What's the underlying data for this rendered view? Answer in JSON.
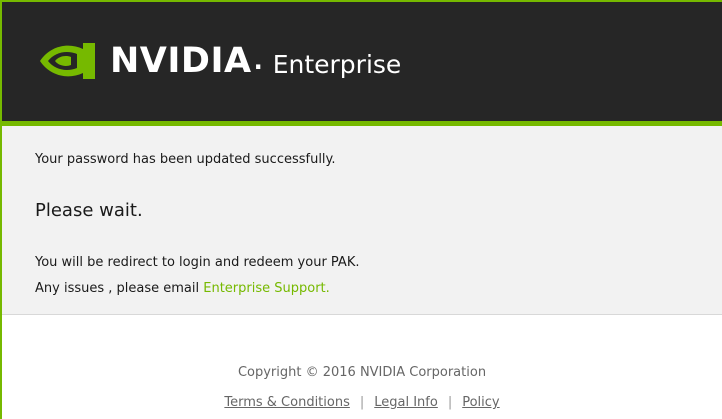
{
  "header": {
    "brand_name": "NVIDIA",
    "brand_dot": ".",
    "product_name": "Enterprise",
    "logo_icon": "nvidia-eye-icon",
    "colors": {
      "background": "#262626",
      "accent": "#76b900"
    }
  },
  "message": {
    "success": "Your password has been updated successfully.",
    "wait": "Please wait.",
    "redirect": "You will be redirect to login and redeem your PAK.",
    "issues_prefix": "Any issues , please email ",
    "support_link": "Enterprise Support."
  },
  "footer": {
    "copyright": "Copyright © 2016 NVIDIA Corporation",
    "links": [
      "Terms & Conditions",
      "Legal Info",
      "Policy"
    ],
    "separator": "|"
  }
}
